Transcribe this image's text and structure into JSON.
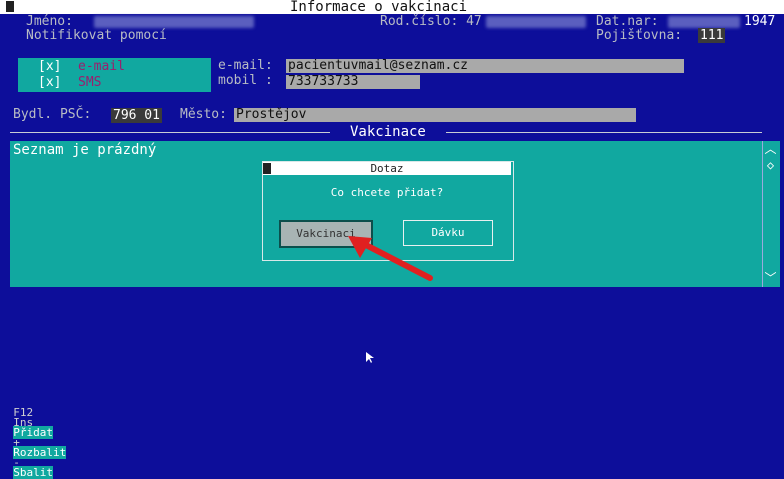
{
  "window": {
    "title": "Informace o vakcinaci"
  },
  "patient": {
    "name_label": "Jméno:",
    "rc_label": "Rod.číslo: 47",
    "dob_label": "Dat.nar:",
    "dob_year": "1947",
    "insurance_label": "Pojišťovna:",
    "insurance_value": "111"
  },
  "notify": {
    "label": "Notifikovat pomocí",
    "email_check": "[x]",
    "email_label": "e-mail",
    "sms_check": "[x]",
    "sms_label": "SMS",
    "email_field_label": "e-mail:",
    "email_value": "pacientuvmail@seznam.cz",
    "mobile_label": "mobil :",
    "mobile_value": "733733733"
  },
  "address": {
    "bydl_label": "Bydl. PSČ:",
    "psc_value": "796 01",
    "mesto_label": "Město:",
    "mesto_value": "Prostějov"
  },
  "vakcinace": {
    "section_title": "Vakcinace",
    "empty_text": "Seznam je prázdný"
  },
  "dialog": {
    "title": "Dotaz",
    "question": "Co chcete přidat?",
    "btn_vakcinaci": "Vakcinaci",
    "btn_davku": "Dávku"
  },
  "footer": {
    "items": [
      "F12",
      "Ins",
      "Přidat",
      "+",
      "Rozbalit",
      "-",
      "Sbalit"
    ]
  },
  "colors": {
    "background": "#0d0e9a",
    "teal": "#11a8a0",
    "arrow": "#e02020"
  }
}
